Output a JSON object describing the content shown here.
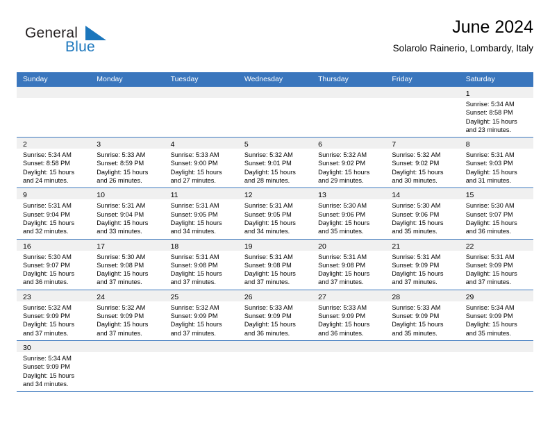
{
  "brand": {
    "name_part1": "General",
    "name_part2": "Blue",
    "flag_icon": "blue-flag-triangle",
    "colors": {
      "dark": "#231f20",
      "blue": "#1b76bc"
    }
  },
  "header": {
    "title": "June 2024",
    "subtitle": "Solarolo Rainerio, Lombardy, Italy"
  },
  "calendar": {
    "header_color": "#3a76bd",
    "weekdays": [
      "Sunday",
      "Monday",
      "Tuesday",
      "Wednesday",
      "Thursday",
      "Friday",
      "Saturday"
    ],
    "weeks": [
      [
        {
          "date": "",
          "lines": []
        },
        {
          "date": "",
          "lines": []
        },
        {
          "date": "",
          "lines": []
        },
        {
          "date": "",
          "lines": []
        },
        {
          "date": "",
          "lines": []
        },
        {
          "date": "",
          "lines": []
        },
        {
          "date": "1",
          "lines": [
            "Sunrise: 5:34 AM",
            "Sunset: 8:58 PM",
            "Daylight: 15 hours",
            "and 23 minutes."
          ]
        }
      ],
      [
        {
          "date": "2",
          "lines": [
            "Sunrise: 5:34 AM",
            "Sunset: 8:58 PM",
            "Daylight: 15 hours",
            "and 24 minutes."
          ]
        },
        {
          "date": "3",
          "lines": [
            "Sunrise: 5:33 AM",
            "Sunset: 8:59 PM",
            "Daylight: 15 hours",
            "and 26 minutes."
          ]
        },
        {
          "date": "4",
          "lines": [
            "Sunrise: 5:33 AM",
            "Sunset: 9:00 PM",
            "Daylight: 15 hours",
            "and 27 minutes."
          ]
        },
        {
          "date": "5",
          "lines": [
            "Sunrise: 5:32 AM",
            "Sunset: 9:01 PM",
            "Daylight: 15 hours",
            "and 28 minutes."
          ]
        },
        {
          "date": "6",
          "lines": [
            "Sunrise: 5:32 AM",
            "Sunset: 9:02 PM",
            "Daylight: 15 hours",
            "and 29 minutes."
          ]
        },
        {
          "date": "7",
          "lines": [
            "Sunrise: 5:32 AM",
            "Sunset: 9:02 PM",
            "Daylight: 15 hours",
            "and 30 minutes."
          ]
        },
        {
          "date": "8",
          "lines": [
            "Sunrise: 5:31 AM",
            "Sunset: 9:03 PM",
            "Daylight: 15 hours",
            "and 31 minutes."
          ]
        }
      ],
      [
        {
          "date": "9",
          "lines": [
            "Sunrise: 5:31 AM",
            "Sunset: 9:04 PM",
            "Daylight: 15 hours",
            "and 32 minutes."
          ]
        },
        {
          "date": "10",
          "lines": [
            "Sunrise: 5:31 AM",
            "Sunset: 9:04 PM",
            "Daylight: 15 hours",
            "and 33 minutes."
          ]
        },
        {
          "date": "11",
          "lines": [
            "Sunrise: 5:31 AM",
            "Sunset: 9:05 PM",
            "Daylight: 15 hours",
            "and 34 minutes."
          ]
        },
        {
          "date": "12",
          "lines": [
            "Sunrise: 5:31 AM",
            "Sunset: 9:05 PM",
            "Daylight: 15 hours",
            "and 34 minutes."
          ]
        },
        {
          "date": "13",
          "lines": [
            "Sunrise: 5:30 AM",
            "Sunset: 9:06 PM",
            "Daylight: 15 hours",
            "and 35 minutes."
          ]
        },
        {
          "date": "14",
          "lines": [
            "Sunrise: 5:30 AM",
            "Sunset: 9:06 PM",
            "Daylight: 15 hours",
            "and 35 minutes."
          ]
        },
        {
          "date": "15",
          "lines": [
            "Sunrise: 5:30 AM",
            "Sunset: 9:07 PM",
            "Daylight: 15 hours",
            "and 36 minutes."
          ]
        }
      ],
      [
        {
          "date": "16",
          "lines": [
            "Sunrise: 5:30 AM",
            "Sunset: 9:07 PM",
            "Daylight: 15 hours",
            "and 36 minutes."
          ]
        },
        {
          "date": "17",
          "lines": [
            "Sunrise: 5:30 AM",
            "Sunset: 9:08 PM",
            "Daylight: 15 hours",
            "and 37 minutes."
          ]
        },
        {
          "date": "18",
          "lines": [
            "Sunrise: 5:31 AM",
            "Sunset: 9:08 PM",
            "Daylight: 15 hours",
            "and 37 minutes."
          ]
        },
        {
          "date": "19",
          "lines": [
            "Sunrise: 5:31 AM",
            "Sunset: 9:08 PM",
            "Daylight: 15 hours",
            "and 37 minutes."
          ]
        },
        {
          "date": "20",
          "lines": [
            "Sunrise: 5:31 AM",
            "Sunset: 9:08 PM",
            "Daylight: 15 hours",
            "and 37 minutes."
          ]
        },
        {
          "date": "21",
          "lines": [
            "Sunrise: 5:31 AM",
            "Sunset: 9:09 PM",
            "Daylight: 15 hours",
            "and 37 minutes."
          ]
        },
        {
          "date": "22",
          "lines": [
            "Sunrise: 5:31 AM",
            "Sunset: 9:09 PM",
            "Daylight: 15 hours",
            "and 37 minutes."
          ]
        }
      ],
      [
        {
          "date": "23",
          "lines": [
            "Sunrise: 5:32 AM",
            "Sunset: 9:09 PM",
            "Daylight: 15 hours",
            "and 37 minutes."
          ]
        },
        {
          "date": "24",
          "lines": [
            "Sunrise: 5:32 AM",
            "Sunset: 9:09 PM",
            "Daylight: 15 hours",
            "and 37 minutes."
          ]
        },
        {
          "date": "25",
          "lines": [
            "Sunrise: 5:32 AM",
            "Sunset: 9:09 PM",
            "Daylight: 15 hours",
            "and 37 minutes."
          ]
        },
        {
          "date": "26",
          "lines": [
            "Sunrise: 5:33 AM",
            "Sunset: 9:09 PM",
            "Daylight: 15 hours",
            "and 36 minutes."
          ]
        },
        {
          "date": "27",
          "lines": [
            "Sunrise: 5:33 AM",
            "Sunset: 9:09 PM",
            "Daylight: 15 hours",
            "and 36 minutes."
          ]
        },
        {
          "date": "28",
          "lines": [
            "Sunrise: 5:33 AM",
            "Sunset: 9:09 PM",
            "Daylight: 15 hours",
            "and 35 minutes."
          ]
        },
        {
          "date": "29",
          "lines": [
            "Sunrise: 5:34 AM",
            "Sunset: 9:09 PM",
            "Daylight: 15 hours",
            "and 35 minutes."
          ]
        }
      ],
      [
        {
          "date": "30",
          "lines": [
            "Sunrise: 5:34 AM",
            "Sunset: 9:09 PM",
            "Daylight: 15 hours",
            "and 34 minutes."
          ]
        },
        {
          "date": "",
          "lines": []
        },
        {
          "date": "",
          "lines": []
        },
        {
          "date": "",
          "lines": []
        },
        {
          "date": "",
          "lines": []
        },
        {
          "date": "",
          "lines": []
        },
        {
          "date": "",
          "lines": []
        }
      ]
    ]
  }
}
